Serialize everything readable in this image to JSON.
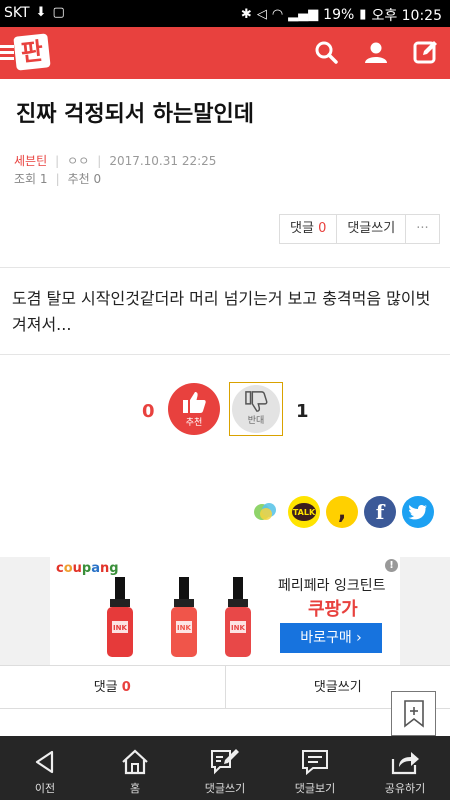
{
  "status_bar": {
    "carrier": "SKT",
    "battery": "19%",
    "time": "오후 10:25"
  },
  "header": {
    "logo_text": "판",
    "icons": [
      "search-icon",
      "user-icon",
      "write-icon"
    ]
  },
  "post": {
    "title": "진짜 걱정되서 하는말인데",
    "author": "세븐틴",
    "nickname": "ㅇㅇ",
    "date": "2017.10.31 22:25",
    "views_label": "조회",
    "views": "1",
    "recommend_label": "추천",
    "recommend": "0",
    "body": "도겸 탈모 시작인것같더라 머리 넘기는거 보고 충격먹음 많이벗겨져서..."
  },
  "actions": {
    "comment_label": "댓글",
    "comment_count": "0",
    "write_comment": "댓글쓰기",
    "more": "···"
  },
  "vote": {
    "up_count": "0",
    "up_label": "추천",
    "down_count": "1",
    "down_label": "반대"
  },
  "share": {
    "kakaotalk_text": "TALK",
    "story_text": ",",
    "facebook_text": "f"
  },
  "ad": {
    "brand": "coupang",
    "headline": "페리페라 잉크틴트",
    "price": "쿠팡가",
    "cta": "바로구매 ›",
    "info": "!",
    "product_label": "INK"
  },
  "comment_tabs": {
    "comments_label": "댓글",
    "comments_count": "0",
    "write_label": "댓글쓰기"
  },
  "bottom_nav": [
    {
      "label": "이전",
      "icon": "back-icon"
    },
    {
      "label": "홈",
      "icon": "home-icon"
    },
    {
      "label": "댓글쓰기",
      "icon": "write-comment-icon"
    },
    {
      "label": "댓글보기",
      "icon": "view-comments-icon"
    },
    {
      "label": "공유하기",
      "icon": "share-icon"
    }
  ],
  "colors": {
    "brand_red": "#e8413e",
    "cta_blue": "#1773de",
    "nav_dark": "#262626"
  }
}
